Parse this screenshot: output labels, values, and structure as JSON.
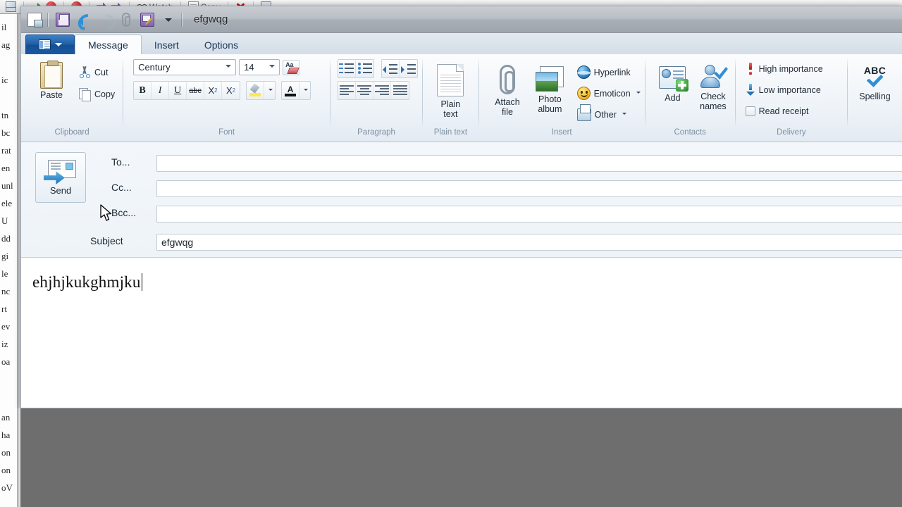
{
  "background_app": {
    "toolbar_items": [
      {
        "label": "",
        "icon": "envelope-icon"
      },
      {
        "label": "",
        "icon": "reply-icon"
      },
      {
        "label": "",
        "icon": "red-circle-icon"
      },
      {
        "label": "",
        "icon": "flag-pin-icon"
      },
      {
        "label": "",
        "icon": "purple-arrow-icon"
      },
      {
        "label": "Watch",
        "icon": "glasses-icon"
      },
      {
        "label": "Copy",
        "icon": "document-icon"
      },
      {
        "label": "",
        "icon": "delete-x-icon"
      },
      {
        "label": "",
        "icon": "printer-icon"
      }
    ],
    "edge_text_lines": [
      "il",
      "ag",
      "",
      "ic",
      "",
      "tn",
      "bc",
      "rat",
      "en",
      "unl",
      "ele",
      "U",
      "dd",
      "gi",
      "le",
      "nc",
      "rt",
      "ev",
      "iz",
      "oa",
      "an",
      "ha",
      "on",
      "on",
      "oV"
    ]
  },
  "window": {
    "title": "efgwqg",
    "quick_access": [
      {
        "name": "new-message",
        "icon": "new-message-icon"
      },
      {
        "name": "save",
        "icon": "save-floppy-icon"
      },
      {
        "name": "undo",
        "icon": "undo-arrow-icon"
      },
      {
        "name": "redo",
        "icon": "redo-arrow-icon"
      },
      {
        "name": "attach",
        "icon": "paperclip-icon"
      },
      {
        "name": "signature",
        "icon": "signature-icon"
      },
      {
        "name": "customize",
        "icon": "chevron-down-icon"
      }
    ]
  },
  "ribbon": {
    "app_button": "app-menu-icon",
    "tabs": [
      {
        "label": "Message",
        "active": true
      },
      {
        "label": "Insert",
        "active": false
      },
      {
        "label": "Options",
        "active": false
      }
    ],
    "groups": {
      "clipboard": {
        "label": "Clipboard",
        "paste": "Paste",
        "cut": "Cut",
        "copy": "Copy"
      },
      "font": {
        "label": "Font",
        "font_name": "Century",
        "font_size": "14",
        "clear_formatting": "Clear formatting",
        "bold": "B",
        "italic": "I",
        "underline": "U",
        "strikethrough": "abc",
        "subscript": "X",
        "subscript_sub": "2",
        "superscript": "X",
        "superscript_sup": "2",
        "highlight": "Highlight",
        "font_color": "A"
      },
      "paragraph": {
        "label": "Paragraph",
        "numbered_list": "Numbered list",
        "bulleted_list": "Bulleted list",
        "decrease_indent": "Decrease indent",
        "increase_indent": "Increase indent",
        "align_left": "Align left",
        "align_center": "Center",
        "align_right": "Align right",
        "justify": "Justify"
      },
      "plain_text": {
        "label": "Plain text",
        "button_line1": "Plain",
        "button_line2": "text"
      },
      "insert": {
        "label": "Insert",
        "attach_line1": "Attach",
        "attach_line2": "file",
        "photo_line1": "Photo",
        "photo_line2": "album",
        "hyperlink": "Hyperlink",
        "emoticon": "Emoticon",
        "other": "Other"
      },
      "contacts": {
        "label": "Contacts",
        "add": "Add",
        "check_line1": "Check",
        "check_line2": "names"
      },
      "delivery": {
        "label": "Delivery",
        "high_importance": "High importance",
        "low_importance": "Low importance",
        "read_receipt": "Read receipt"
      },
      "spelling": {
        "abc": "ABC",
        "label": "Spelling"
      }
    }
  },
  "compose": {
    "send_button": "Send",
    "fields": [
      {
        "label": "To...",
        "value": "",
        "name": "to"
      },
      {
        "label": "Cc...",
        "value": "",
        "name": "cc"
      },
      {
        "label": "Bcc...",
        "value": "",
        "name": "bcc"
      },
      {
        "label": "Subject",
        "value": "efgwqg",
        "name": "subject"
      }
    ],
    "body_text": "ehjhjkukghmjku"
  },
  "colors": {
    "accent_blue": "#1f5fa8",
    "ribbon_bg": "#eef3f8",
    "titlebar": "#b5bac1",
    "letterbox": "#6e6e6e",
    "field_border": "#c3ccd5"
  }
}
